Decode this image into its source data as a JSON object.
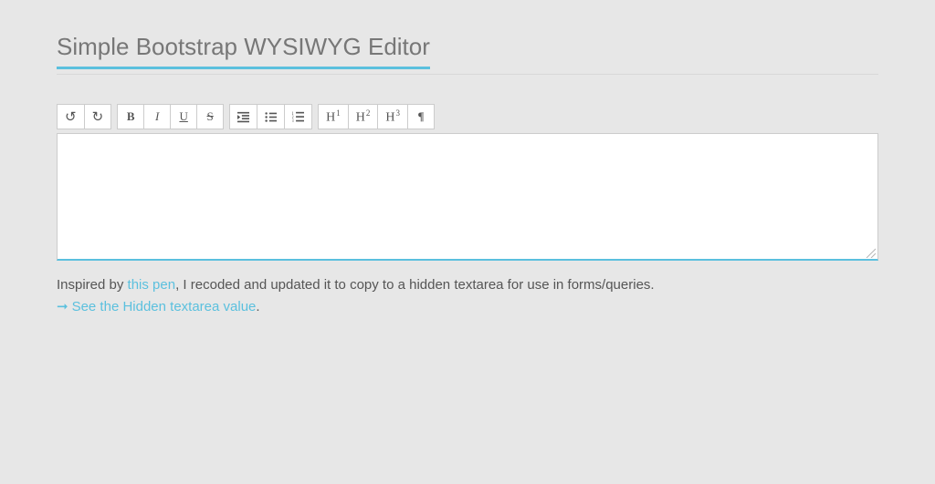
{
  "title": "Simple Bootstrap WYSIWYG Editor",
  "toolbar": {
    "undo": "↺",
    "redo": "↻",
    "bold": "B",
    "italic": "I",
    "underline": "U",
    "strike": "S",
    "h": "H",
    "h1sup": "1",
    "h2sup": "2",
    "h3sup": "3",
    "para": "¶"
  },
  "description": {
    "prefix": "Inspired by ",
    "link1": "this pen",
    "middle": ", I recoded and updated it to copy to a hidden textarea for use in forms/queries."
  },
  "seeLink": {
    "text": "See the Hidden textarea value",
    "period": "."
  }
}
